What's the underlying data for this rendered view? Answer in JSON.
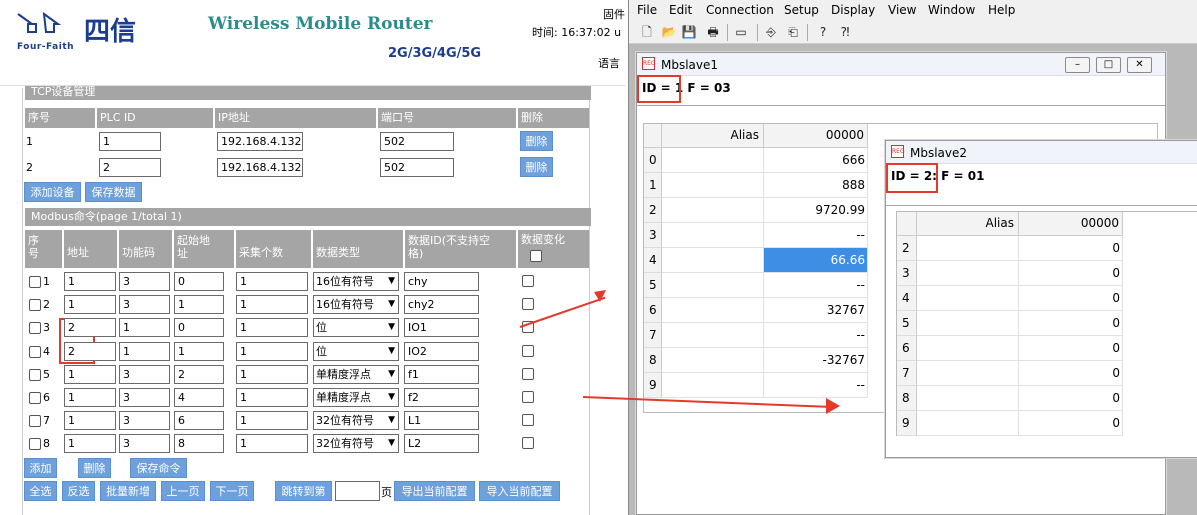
{
  "header": {
    "brand": "Four-Faith",
    "logo_text": "四信",
    "product_title": "Wireless Mobile Router",
    "product_sub": "2G/3G/4G/5G",
    "time_label": "时间: 16:37:02 u",
    "fw_label": "固件",
    "lang_label": "语言"
  },
  "tcp": {
    "section_title": "TCP设备管理",
    "columns": [
      "序号",
      "PLC ID",
      "IP地址",
      "端口号",
      "删除"
    ],
    "rows": [
      {
        "no": "1",
        "plc_id": "1",
        "ip": "192.168.4.132",
        "port": "502",
        "delete": "删除"
      },
      {
        "no": "2",
        "plc_id": "2",
        "ip": "192.168.4.132",
        "port": "502",
        "delete": "删除"
      }
    ],
    "add_label": "添加设备",
    "save_label": "保存数据"
  },
  "modbus": {
    "section_title": "Modbus命令(page 1/total 1)",
    "columns": [
      "序\n号",
      "地址",
      "功能码",
      "起始地\n址",
      "采集个数",
      "数据类型",
      "数据ID(不支持空\n格)",
      "数据变化"
    ],
    "rows": [
      {
        "no": "1",
        "addr": "1",
        "func": "3",
        "start": "0",
        "count": "1",
        "type": "16位有符号",
        "id": "chy"
      },
      {
        "no": "2",
        "addr": "1",
        "func": "3",
        "start": "1",
        "count": "1",
        "type": "16位有符号",
        "id": "chy2"
      },
      {
        "no": "3",
        "addr": "2",
        "func": "1",
        "start": "0",
        "count": "1",
        "type": "位",
        "id": "IO1"
      },
      {
        "no": "4",
        "addr": "2",
        "func": "1",
        "start": "1",
        "count": "1",
        "type": "位",
        "id": "IO2"
      },
      {
        "no": "5",
        "addr": "1",
        "func": "3",
        "start": "2",
        "count": "1",
        "type": "单精度浮点",
        "id": "f1"
      },
      {
        "no": "6",
        "addr": "1",
        "func": "3",
        "start": "4",
        "count": "1",
        "type": "单精度浮点",
        "id": "f2"
      },
      {
        "no": "7",
        "addr": "1",
        "func": "3",
        "start": "6",
        "count": "1",
        "type": "32位有符号",
        "id": "L1"
      },
      {
        "no": "8",
        "addr": "1",
        "func": "3",
        "start": "8",
        "count": "1",
        "type": "32位有符号",
        "id": "L2"
      }
    ],
    "buttons_row1": [
      "添加",
      "删除",
      "保存命令"
    ],
    "buttons_row2": [
      "全选",
      "反选",
      "批量新增",
      "上一页",
      "下一页",
      "跳转到第"
    ],
    "page_suffix": "页",
    "export_label": "导出当前配置",
    "import_label": "导入当前配置"
  },
  "app": {
    "menu": [
      "File",
      "Edit",
      "Connection",
      "Setup",
      "Display",
      "View",
      "Window",
      "Help"
    ],
    "toolbar_icons": [
      "new-icon",
      "open-icon",
      "save-icon",
      "print-icon",
      "window-icon",
      "connect-icon",
      "disconnect-icon",
      "help-icon",
      "context-help-icon"
    ],
    "toolbar_glyphs": [
      "🗋",
      "📂",
      "💾",
      "🖶",
      "▭",
      "⎆",
      "⎗",
      "?",
      "⁈"
    ]
  },
  "slave1": {
    "title": "Mbslave1",
    "status_id": "ID = 1",
    "status_f": " F = 03",
    "col_alias": "Alias",
    "col_value": "00000",
    "rows": [
      {
        "n": "0",
        "v": "666"
      },
      {
        "n": "1",
        "v": "888"
      },
      {
        "n": "2",
        "v": "9720.99"
      },
      {
        "n": "3",
        "v": "--"
      },
      {
        "n": "4",
        "v": "66.66"
      },
      {
        "n": "5",
        "v": "--"
      },
      {
        "n": "6",
        "v": "32767"
      },
      {
        "n": "7",
        "v": "--"
      },
      {
        "n": "8",
        "v": "-32767"
      },
      {
        "n": "9",
        "v": "--"
      }
    ],
    "selected_row": 4
  },
  "slave2": {
    "title": "Mbslave2",
    "status_id": "ID = 2:",
    "status_f": " F = 01",
    "col_alias": "Alias",
    "col_value": "00000",
    "rows": [
      {
        "n": "2",
        "v": "0"
      },
      {
        "n": "3",
        "v": "0"
      },
      {
        "n": "4",
        "v": "0"
      },
      {
        "n": "5",
        "v": "0"
      },
      {
        "n": "6",
        "v": "0"
      },
      {
        "n": "7",
        "v": "0"
      },
      {
        "n": "8",
        "v": "0"
      },
      {
        "n": "9",
        "v": "0"
      }
    ]
  },
  "colors": {
    "accent_button": "#6ea0dc",
    "section_header": "#a5a5a5",
    "highlight_red": "#e5392b",
    "selected_cell": "#3e8ee6"
  }
}
